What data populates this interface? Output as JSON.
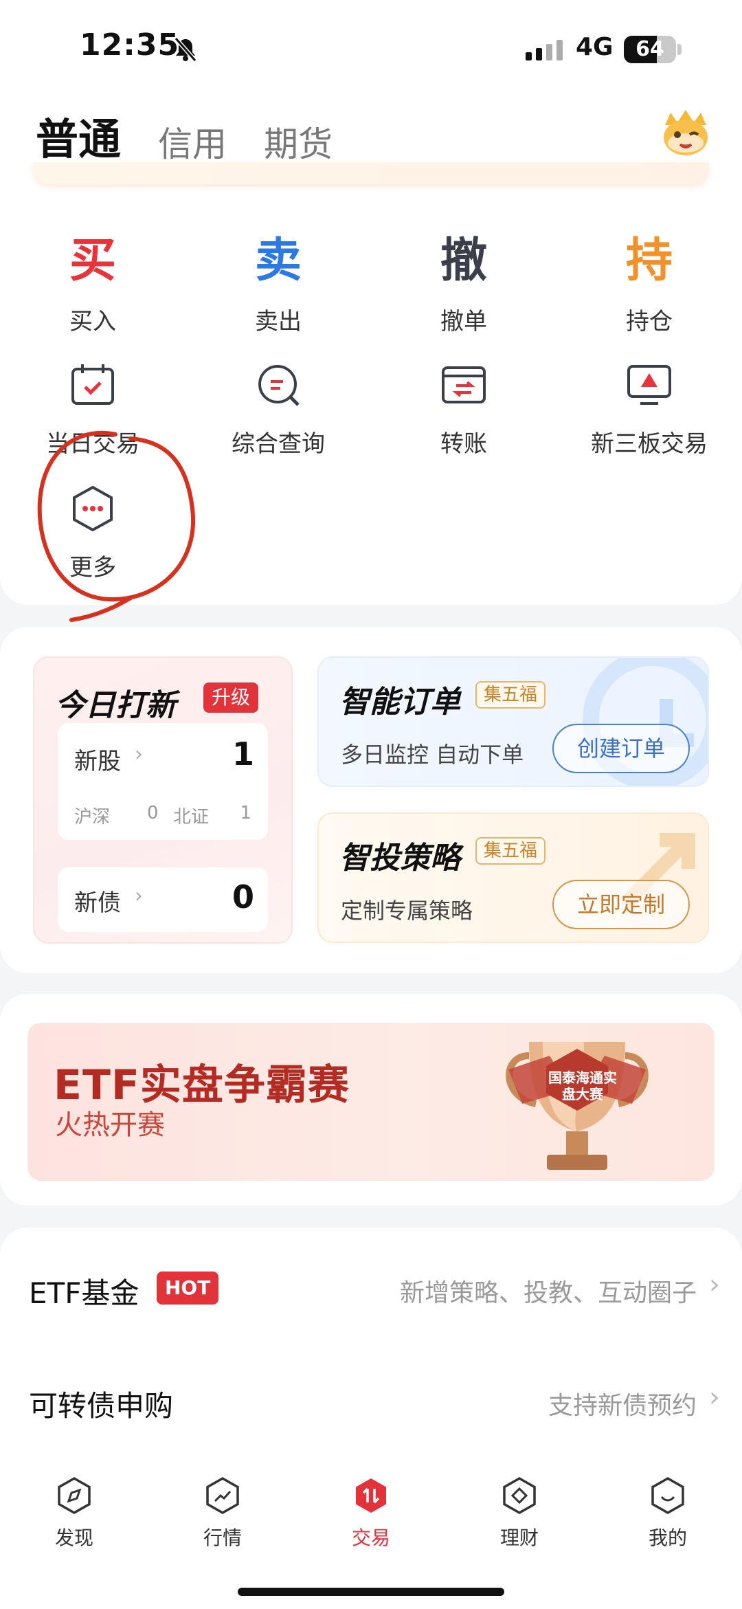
{
  "status_bar": {
    "time": "12:35",
    "network": "4G",
    "battery": "64"
  },
  "header": {
    "tabs": [
      {
        "label": "普通",
        "active": true
      },
      {
        "label": "信用",
        "active": false
      },
      {
        "label": "期货",
        "active": false
      }
    ]
  },
  "actions": [
    {
      "glyph": "买",
      "label": "买入",
      "color": "#e8333a"
    },
    {
      "glyph": "卖",
      "label": "卖出",
      "color": "#2c79e6"
    },
    {
      "glyph": "撤",
      "label": "撤单",
      "color": "#3a3f4a"
    },
    {
      "glyph": "持",
      "label": "持仓",
      "color": "#f0912a"
    }
  ],
  "tools": [
    {
      "icon": "calendar-check-icon",
      "label": "当日交易"
    },
    {
      "icon": "search-query-icon",
      "label": "综合查询"
    },
    {
      "icon": "transfer-icon",
      "label": "转账"
    },
    {
      "icon": "monitor-icon",
      "label": "新三板交易"
    },
    {
      "icon": "more-icon",
      "label": "更多"
    }
  ],
  "ipo": {
    "title": "今日打新",
    "badge": "升级",
    "stock_label": "新股",
    "stock_count": "1",
    "hs_label": "沪深",
    "hs_count": "0",
    "bz_label": "北证",
    "bz_count": "1",
    "bond_label": "新债",
    "bond_count": "0"
  },
  "smart_order": {
    "title": "智能订单",
    "tag": "集五福",
    "desc": "多日监控 自动下单",
    "button": "创建订单"
  },
  "strategy": {
    "title": "智投策略",
    "tag": "集五福",
    "desc": "定制专属策略",
    "button": "立即定制"
  },
  "banner": {
    "title": "ETF实盘争霸赛",
    "subtitle": "火热开赛",
    "trophy_text": "国泰海通实盘大赛"
  },
  "list": [
    {
      "title": "ETF基金",
      "badge": "HOT",
      "right": "新增策略、投教、互动圈子"
    },
    {
      "title": "可转债申购",
      "badge": "",
      "right": "支持新债预约"
    }
  ],
  "bottom_nav": [
    {
      "icon": "compass-icon",
      "label": "发现",
      "active": false
    },
    {
      "icon": "trend-icon",
      "label": "行情",
      "active": false
    },
    {
      "icon": "trade-icon",
      "label": "交易",
      "active": true
    },
    {
      "icon": "wealth-icon",
      "label": "理财",
      "active": false
    },
    {
      "icon": "profile-icon",
      "label": "我的",
      "active": false
    }
  ],
  "colors": {
    "accent_red": "#e3333a",
    "blue": "#2c79e6",
    "orange": "#f0912a",
    "annotation": "#d6301e"
  }
}
